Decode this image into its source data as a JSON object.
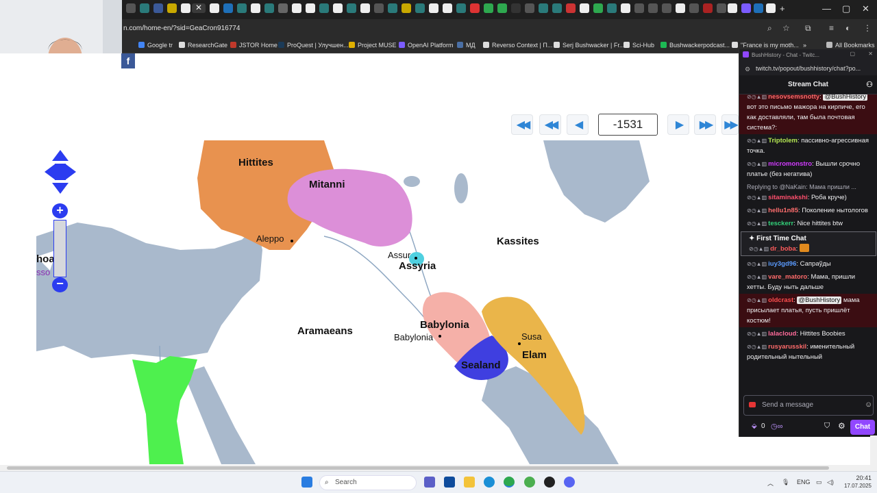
{
  "browser": {
    "url": "n.com/home-en/?sid=GeaCron916774",
    "bookmarks": [
      {
        "label": "Google tr",
        "color": "#4285f4"
      },
      {
        "label": "ResearchGate",
        "color": "#ffffff"
      },
      {
        "label": "JSTOR Home",
        "color": "#c0392b"
      },
      {
        "label": "ProQuest | Улучшен...",
        "color": "#1b3a57"
      },
      {
        "label": "Project MUSE",
        "color": "#e0b000"
      },
      {
        "label": "OpenAI Platform",
        "color": "#7b5cff"
      },
      {
        "label": "МД",
        "color": "#4a6fa5"
      },
      {
        "label": "Reverso Context | П...",
        "color": "#ffffff"
      },
      {
        "label": "Serj Bushwacker | Fr...",
        "color": "#ffffff"
      },
      {
        "label": "Sci-Hub",
        "color": "#ffffff"
      },
      {
        "label": "Bushwackerpodcast...",
        "color": "#1db954"
      },
      {
        "label": "\"France is my moth...",
        "color": "#ffffff"
      },
      {
        "label": "All Bookmarks",
        "color": "#bbbbbb"
      }
    ]
  },
  "timeline": {
    "year": "-1531"
  },
  "map": {
    "regions": [
      {
        "name": "Hittites",
        "color": "#e8924f"
      },
      {
        "name": "Mitanni",
        "color": "#dc8fd8"
      },
      {
        "name": "Assyria",
        "color": "#4fd0e0"
      },
      {
        "name": "Kassites",
        "color": ""
      },
      {
        "name": "Aramaeans",
        "color": ""
      },
      {
        "name": "Babylonia",
        "color": "#f5b0a8"
      },
      {
        "name": "Elam",
        "color": "#eab54a"
      },
      {
        "name": "Sealand",
        "color": "#3f3fe0"
      }
    ],
    "cities": [
      "Aleppo",
      "Assur",
      "Babylonia",
      "Susa"
    ],
    "cut_labels": [
      "hoan",
      "sso"
    ],
    "water_color": "#a9b9cc"
  },
  "chat": {
    "window_title": "BushHistory - Chat - Twitc...",
    "url": "twitch.tv/popout/bushhistory/chat?po...",
    "header": "Stream Chat",
    "messages": [
      {
        "user": "nesovsemsnotty",
        "user_color": "#ff6b6b",
        "mention": "@BushHistory",
        "text": "вот это письмо мажора на кирпиче, его как доставляли, там была почтовая система?:",
        "highlight": true
      },
      {
        "user": "Triptolem",
        "user_color": "#b5e853",
        "mention": "",
        "text": "пассивно-агрессивная точка.",
        "highlight": false
      },
      {
        "user": "micromonstro",
        "user_color": "#d13bff",
        "mention": "",
        "text": "Вышли срочно платье (без негатива)",
        "highlight": false
      },
      {
        "reply": "Replying to @NaKain: Мама пришли ...",
        "user": "sitaminakshi",
        "user_color": "#ff4f6d",
        "mention": "",
        "text": "Роба круче)",
        "highlight": false
      },
      {
        "user": "hellu1n85",
        "user_color": "#ff6e6e",
        "mention": "",
        "text": "Поколение нытологов",
        "highlight": false
      },
      {
        "user": "tesckerr",
        "user_color": "#33d17a",
        "mention": "",
        "text": "Nice hittites btw",
        "highlight": false
      },
      {
        "first_title": "First Time Chat",
        "user": "dr_boba",
        "user_color": "#ff5b5b",
        "mention": "",
        "text": "",
        "highlight": false
      },
      {
        "user": "iuy3gd96",
        "user_color": "#5b9bff",
        "mention": "",
        "text": "Сапраўды",
        "highlight": false
      },
      {
        "user": "vare_matoro",
        "user_color": "#ff6b6b",
        "mention": "",
        "text": "Мама, пришли хетты. Буду ныть дальше",
        "highlight": false
      },
      {
        "user": "oldcrast",
        "user_color": "#ff4f4f",
        "mention": "@BushHistory",
        "text": "мама присылает платья, пусть пришлёт костюм!",
        "highlight": true
      },
      {
        "user": "lalacloud",
        "user_color": "#ff6b9a",
        "mention": "",
        "text": "Hittites Boobies",
        "highlight": false
      },
      {
        "user": "rusyarusskil",
        "user_color": "#ff6b6b",
        "mention": "",
        "text": "именительный родительный нытельный",
        "highlight": false
      }
    ],
    "input_placeholder": "Send a message",
    "points": "0",
    "chat_button": "Chat"
  },
  "taskbar": {
    "search": "Search",
    "lang": "ENG",
    "time": "20:41",
    "date": "17.07.2025"
  }
}
